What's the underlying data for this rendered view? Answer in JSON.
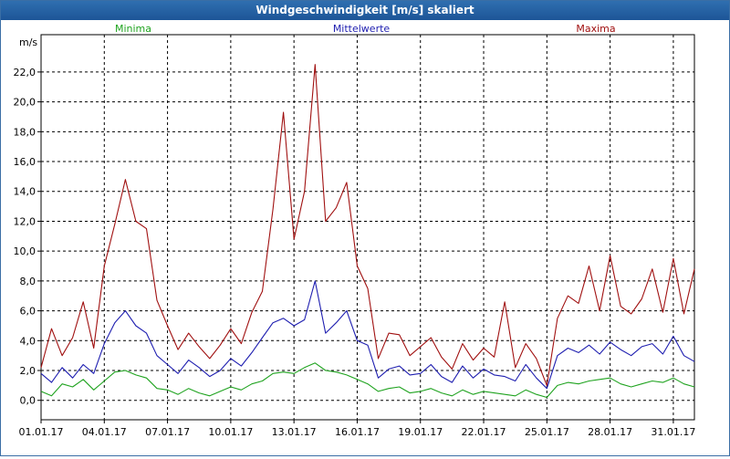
{
  "window": {
    "title": "Windgeschwindigkeit [m/s] skaliert"
  },
  "colors": {
    "min": "#1fa31f",
    "mean": "#1f1fb0",
    "max": "#a01010",
    "title_bg": "#2260a0",
    "grid": "#000000"
  },
  "chart_data": {
    "type": "line",
    "title": "Windgeschwindigkeit [m/s] skaliert",
    "ylabel": "m/s",
    "xlabel": "",
    "ylim": [
      -1.3,
      24.5
    ],
    "xlim": [
      0,
      31
    ],
    "grid": true,
    "y_ticks": [
      "0,0",
      "2,0",
      "4,0",
      "6,0",
      "8,0",
      "10,0",
      "12,0",
      "14,0",
      "16,0",
      "18,0",
      "20,0",
      "22,0"
    ],
    "y_tick_values": [
      0,
      2,
      4,
      6,
      8,
      10,
      12,
      14,
      16,
      18,
      20,
      22
    ],
    "x_ticks": [
      "01.01.17",
      "04.01.17",
      "07.01.17",
      "10.01.17",
      "13.01.17",
      "16.01.17",
      "19.01.17",
      "22.01.17",
      "25.01.17",
      "28.01.17",
      "31.01.17"
    ],
    "x_tick_values": [
      0,
      3,
      6,
      9,
      12,
      15,
      18,
      21,
      24,
      27,
      30
    ],
    "legend": [
      "Minima",
      "Mittelwerte",
      "Maxima"
    ],
    "x": [
      0,
      0.5,
      1,
      1.5,
      2,
      2.5,
      3,
      3.5,
      4,
      4.5,
      5,
      5.5,
      6,
      6.5,
      7,
      7.5,
      8,
      8.5,
      9,
      9.5,
      10,
      10.5,
      11,
      11.5,
      12,
      12.5,
      13,
      13.5,
      14,
      14.5,
      15,
      15.5,
      16,
      16.5,
      17,
      17.5,
      18,
      18.5,
      19,
      19.5,
      20,
      20.5,
      21,
      21.5,
      22,
      22.5,
      23,
      23.5,
      24,
      24.5,
      25,
      25.5,
      26,
      26.5,
      27,
      27.5,
      28,
      28.5,
      29,
      29.5,
      30,
      30.5,
      31
    ],
    "series": [
      {
        "name": "Minima",
        "values": [
          0.6,
          0.3,
          1.1,
          0.9,
          1.4,
          0.7,
          1.3,
          1.9,
          2.0,
          1.7,
          1.5,
          0.8,
          0.7,
          0.4,
          0.8,
          0.5,
          0.3,
          0.6,
          0.9,
          0.7,
          1.1,
          1.3,
          1.8,
          1.9,
          1.8,
          2.2,
          2.5,
          2.0,
          1.9,
          1.7,
          1.4,
          1.1,
          0.6,
          0.8,
          0.9,
          0.5,
          0.6,
          0.8,
          0.5,
          0.3,
          0.7,
          0.4,
          0.6,
          0.5,
          0.4,
          0.3,
          0.7,
          0.4,
          0.2,
          1.0,
          1.2,
          1.1,
          1.3,
          1.4,
          1.5,
          1.1,
          0.9,
          1.1,
          1.3,
          1.2,
          1.5,
          1.1,
          0.9
        ]
      },
      {
        "name": "Mittelwerte",
        "values": [
          1.8,
          1.2,
          2.2,
          1.5,
          2.4,
          1.8,
          3.8,
          5.2,
          6.0,
          5.0,
          4.5,
          3.0,
          2.4,
          1.8,
          2.7,
          2.2,
          1.6,
          2.0,
          2.8,
          2.3,
          3.2,
          4.2,
          5.2,
          5.5,
          5.0,
          5.4,
          8.0,
          4.5,
          5.2,
          6.0,
          4.0,
          3.7,
          1.5,
          2.1,
          2.3,
          1.7,
          1.8,
          2.4,
          1.6,
          1.2,
          2.3,
          1.5,
          2.1,
          1.7,
          1.6,
          1.3,
          2.4,
          1.5,
          0.8,
          3.0,
          3.5,
          3.2,
          3.7,
          3.1,
          3.9,
          3.4,
          3.0,
          3.6,
          3.8,
          3.1,
          4.3,
          3.0,
          2.6
        ]
      },
      {
        "name": "Maxima",
        "values": [
          2.2,
          4.8,
          3.0,
          4.2,
          6.6,
          3.5,
          9.0,
          11.8,
          14.8,
          12.0,
          11.5,
          6.7,
          5.0,
          3.4,
          4.5,
          3.6,
          2.8,
          3.7,
          4.8,
          3.8,
          5.9,
          7.3,
          12.8,
          19.3,
          10.8,
          14.0,
          22.5,
          12.0,
          12.9,
          14.6,
          9.0,
          7.5,
          2.8,
          4.5,
          4.4,
          3.0,
          3.6,
          4.2,
          2.9,
          2.1,
          3.8,
          2.7,
          3.5,
          2.9,
          6.6,
          2.2,
          3.8,
          2.8,
          1.0,
          5.5,
          7.0,
          6.5,
          9.0,
          6.0,
          9.7,
          6.3,
          5.8,
          6.8,
          8.8,
          5.9,
          9.5,
          5.8,
          8.8
        ]
      }
    ]
  }
}
